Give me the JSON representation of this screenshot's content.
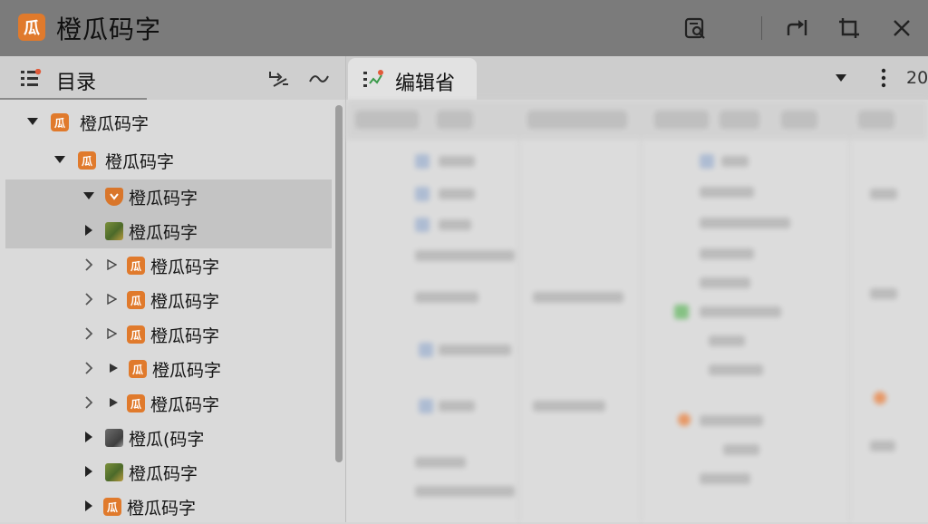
{
  "window": {
    "title": "橙瓜码字",
    "logo_text": "瓜",
    "icons": [
      "search-doc-icon",
      "redirect-icon",
      "crop-icon",
      "close-icon"
    ]
  },
  "left_panel": {
    "title": "目录",
    "tree": [
      {
        "label": "橙瓜码字",
        "level": 0,
        "expanded": true,
        "icon": "orange-book-icon"
      },
      {
        "label": "橙瓜码字",
        "level": 1,
        "expanded": true,
        "icon": "orange-book-icon"
      },
      {
        "label": "橙瓜码字",
        "level": 2,
        "expanded": true,
        "icon": "shield-icon",
        "selected": true
      },
      {
        "label": "橙瓜码字",
        "level": 2,
        "expanded": false,
        "icon": "photo-icon",
        "selected": true
      },
      {
        "label": "橙瓜码字",
        "level": 3,
        "icon": "orange-book-icon",
        "sub": "play-outline"
      },
      {
        "label": "橙瓜码字",
        "level": 3,
        "icon": "orange-book-icon",
        "sub": "play-outline"
      },
      {
        "label": "橙瓜码字",
        "level": 3,
        "icon": "orange-book-icon",
        "sub": "play-outline"
      },
      {
        "label": "橙瓜码字",
        "level": 3,
        "icon": "orange-book-icon",
        "sub": "play-filled"
      },
      {
        "label": "橙瓜码字",
        "level": 3,
        "icon": "orange-book-icon",
        "sub": "play-filled"
      },
      {
        "label": "橙瓜(码字",
        "level": 2,
        "expanded": false,
        "icon": "photo2-icon"
      },
      {
        "label": "橙瓜码字",
        "level": 2,
        "expanded": false,
        "icon": "photo-icon"
      },
      {
        "label": "橙瓜码字",
        "level": 2,
        "expanded": false,
        "icon": "orange-book-icon"
      }
    ]
  },
  "editor": {
    "tab_label": "编辑省",
    "truncated_text": "20"
  },
  "colors": {
    "accent": "#e07a2c",
    "titlebar": "#7b7b7b",
    "selection": "#c4c4c4"
  }
}
